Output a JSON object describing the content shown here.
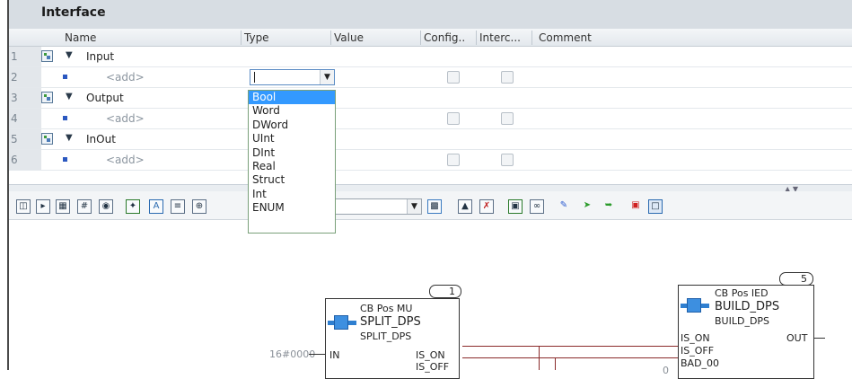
{
  "interface": {
    "title": "Interface",
    "columns": [
      "Name",
      "Type",
      "Value",
      "Config..",
      "Interc...",
      "Comment"
    ],
    "rows": [
      {
        "num": "1",
        "kind": "section",
        "name": "Input"
      },
      {
        "num": "2",
        "kind": "add",
        "name": "<add>"
      },
      {
        "num": "3",
        "kind": "section",
        "name": "Output"
      },
      {
        "num": "4",
        "kind": "add",
        "name": "<add>"
      },
      {
        "num": "5",
        "kind": "section",
        "name": "InOut"
      },
      {
        "num": "6",
        "kind": "add",
        "name": "<add>"
      }
    ],
    "type_dropdown": {
      "selected": "Bool",
      "options": [
        "Bool",
        "Word",
        "DWord",
        "UInt",
        "DInt",
        "Real",
        "Struct",
        "Int",
        "ENUM"
      ]
    }
  },
  "toolbar": {
    "icons": [
      "columns-icon",
      "split-icon",
      "grid-icon",
      "hash-icon",
      "network-icon",
      "wizard-icon",
      "font-icon",
      "list-icon",
      "zoom-icon",
      "chart-icon",
      "sheet-icon",
      "crossref-icon",
      "mark-icon",
      "link-icon",
      "pencil-icon",
      "arrow-in-icon",
      "arrow-out-icon",
      "lock-icon",
      "unlock-icon"
    ]
  },
  "diagram": {
    "block1": {
      "number": "1",
      "instance": "CB Pos MU",
      "type": "SPLIT_DPS",
      "subtype": "SPLIT_DPS",
      "in_pin": "IN",
      "out_pins": [
        "IS_ON",
        "IS_OFF"
      ],
      "in_value": "16#0000"
    },
    "block2": {
      "number": "5",
      "instance": "CB Pos IED",
      "type": "BUILD_DPS",
      "subtype": "BUILD_DPS",
      "in_pins": [
        "IS_ON",
        "IS_OFF",
        "BAD_00"
      ],
      "out_pin": "OUT",
      "bad_value": "0"
    },
    "colors": {
      "wire": "#8a2b2b",
      "block_icon": "#2f7fd0"
    }
  }
}
